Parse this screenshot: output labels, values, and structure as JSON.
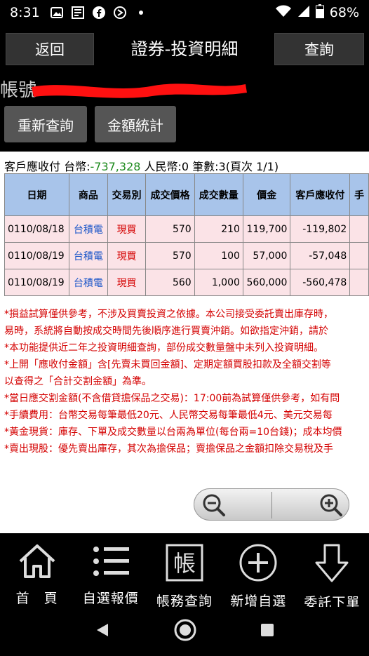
{
  "status_bar": {
    "time": "8:31",
    "battery": "68%",
    "icons": [
      "image-icon",
      "news-icon",
      "facebook-icon",
      "media-icon",
      "dot-icon",
      "wifi-icon",
      "signal-icon",
      "battery-icon"
    ]
  },
  "header": {
    "back_label": "返回",
    "title": "證券-投資明細",
    "query_label": "查詢"
  },
  "account": {
    "label": "帳號"
  },
  "actions": {
    "requery_label": "重新查詢",
    "stats_label": "金額統計"
  },
  "summary": {
    "prefix": "客戶應收付 台幣:",
    "twd_value": "-737,328",
    "rest": " 人民幣:0 筆數:3(頁次 1/1)"
  },
  "table": {
    "headers": [
      "日期",
      "商品",
      "交易別",
      "成交價格",
      "成交數量",
      "價金",
      "客戶應收付",
      "手"
    ],
    "rows": [
      [
        "0110/08/18",
        "台積電",
        "現買",
        "570",
        "210",
        "119,700",
        "-119,802",
        ""
      ],
      [
        "0110/08/19",
        "台積電",
        "現買",
        "570",
        "100",
        "57,000",
        "-57,048",
        ""
      ],
      [
        "0110/08/19",
        "台積電",
        "現買",
        "560",
        "1,000",
        "560,000",
        "-560,478",
        ""
      ]
    ]
  },
  "notes": [
    "*損益試算僅供參考，不涉及買賣投資之依據。本公司接受委託賣出庫存時，",
    "易時，系統將自動按成交時間先後順序進行買賣沖銷。如欲指定沖銷，請於",
    "*本功能提供近二年之投資明細查詢，部份成交數量盤中未列入投資明細。",
    "*上開「應收付金額」含[先賣未買回金額]、定期定額買股扣款及全額交割等",
    "以查得之「合計交割金額」為準。",
    "*當日應交割金額(不含借貸擔保品之交易)：17:00前為試算僅供參考，如有問",
    "*手續費用：台幣交易每筆最低20元、人民幣交易每筆最低4元、美元交易每",
    "*黃金現貨：庫存、下單及成交數量以台兩為單位(每台兩=10台錢)；成本均價",
    "*賣出現股：優先賣出庫存，其次為擔保品；賣擔保品之金額扣除交易稅及手"
  ],
  "bottom_nav": [
    {
      "label": "首　頁",
      "icon": "home-icon"
    },
    {
      "label": "自選報價",
      "icon": "list-icon"
    },
    {
      "label": "帳務查詢",
      "icon": "account-icon",
      "icon_text": "帳"
    },
    {
      "label": "新增自選",
      "icon": "plus-icon"
    },
    {
      "label": "委託下單",
      "icon": "order-down-icon"
    }
  ],
  "colors": {
    "header_bg": "#000000",
    "table_header": "#a8c4ea",
    "row_bg": "#fbe3e7",
    "product": "#1a55c8",
    "buy": "#d40000",
    "negative": "#1c8a1c"
  }
}
